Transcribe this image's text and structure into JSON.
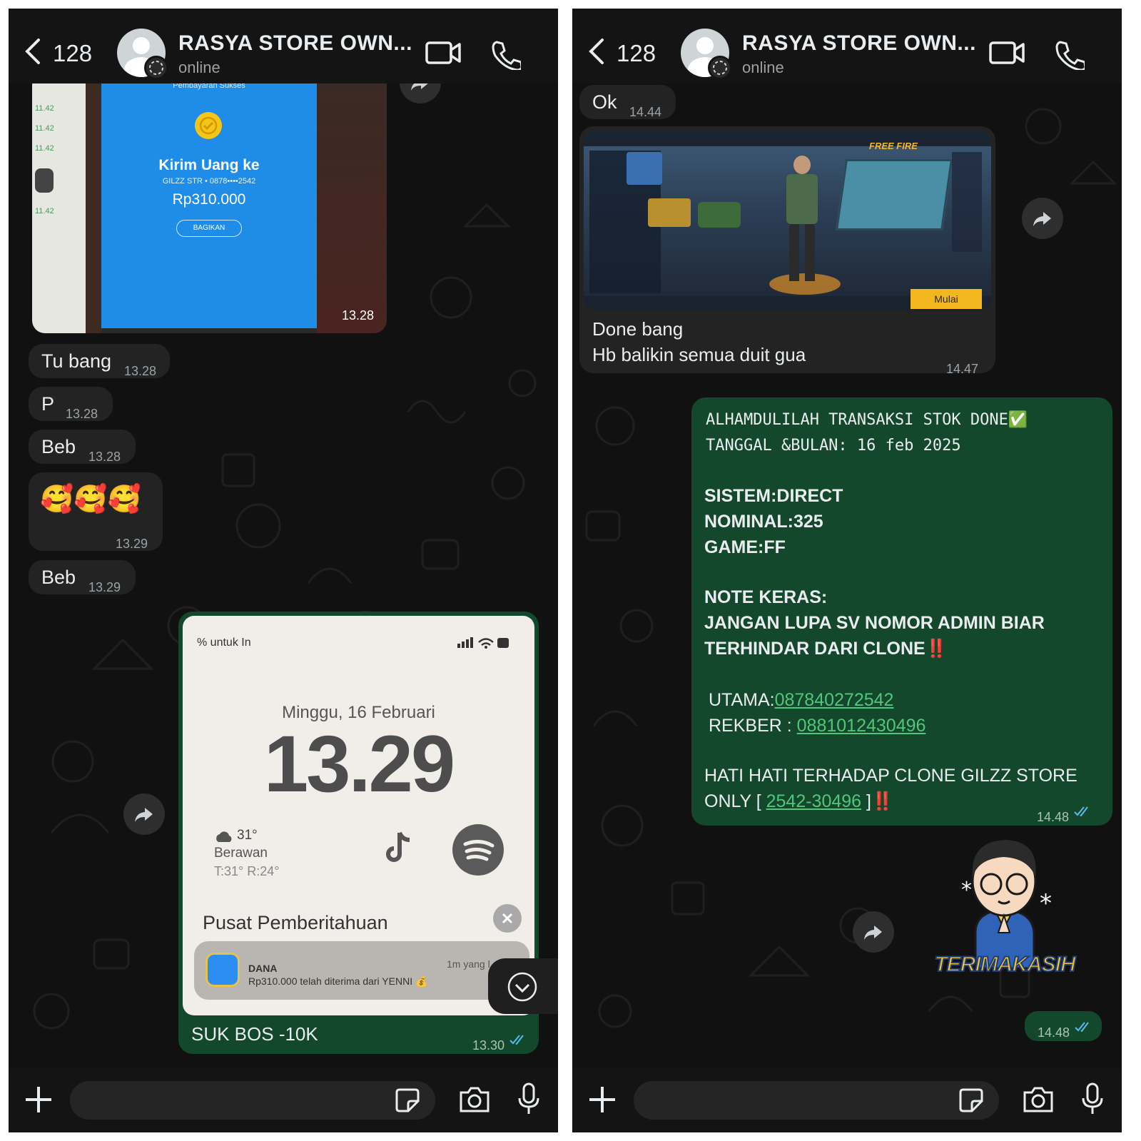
{
  "left": {
    "header": {
      "back_count": "128",
      "contact_name": "RASYA STORE OWN...",
      "status": "online"
    },
    "messages": {
      "image1": {
        "time": "13.28",
        "receipt_header": "Pembayaran Sukses",
        "receipt_title": "Kirim Uang ke",
        "receipt_sub": "GILZZ STR • 0878••••2542",
        "receipt_amount": "Rp310.000",
        "receipt_share": "BAGIKAN",
        "side_times": [
          "11.42",
          "11.42",
          "11.42",
          "11.42"
        ]
      },
      "m1": {
        "text": "Tu bang",
        "time": "13.28"
      },
      "m2": {
        "text": "P",
        "time": "13.28"
      },
      "m3": {
        "text": "Beb",
        "time": "13.28"
      },
      "m4": {
        "emoji": "🥰🥰🥰",
        "time": "13.29"
      },
      "m5": {
        "text": "Beb",
        "time": "13.29"
      },
      "image2": {
        "status_text": "% untuk In",
        "date": "Minggu, 16 Februari",
        "clock": "13.29",
        "weather_temp": "31°",
        "weather_desc": "Berawan",
        "weather_range": "T:31° R:24°",
        "notif_center": "Pusat Pemberitahuan",
        "notif_app": "DANA",
        "notif_text": "Rp310.000 telah diterima dari YENNI 💰",
        "notif_time": "1m yang l",
        "caption": "SUK BOS -10K",
        "time": "13.30"
      }
    }
  },
  "right": {
    "header": {
      "back_count": "128",
      "contact_name": "RASYA STORE OWN...",
      "status": "online"
    },
    "messages": {
      "m1": {
        "text": "Ok",
        "time": "14.44"
      },
      "image1": {
        "game_logo": "FREE FIRE",
        "start_button": "Mulai",
        "caption_line1": "Done bang",
        "caption_line2": "Hb balikin semua duit gua",
        "time": "14.47"
      },
      "m2": {
        "line1": "ALHAMDULILAH TRANSAKSI STOK DONE✅",
        "line2": "TANGGAL &BULAN: 16 feb 2025",
        "sistem": "SISTEM:DIRECT",
        "nominal": "NOMINAL:325",
        "game": "GAME:FF",
        "note_title": "NOTE KERAS:",
        "note_line1": "JANGAN LUPA SV NOMOR ADMIN BIAR",
        "note_line2": "TERHINDAR DARI CLONE‼️",
        "utama_label": "UTAMA:",
        "utama_number": "087840272542",
        "rekber_label": "REKBER : ",
        "rekber_number": "0881012430496",
        "warn_line1": "HATI HATI TERHADAP CLONE GILZZ STORE",
        "warn_prefix": "ONLY [ ",
        "warn_link": "2542-30496",
        "warn_suffix": " ]‼️",
        "time": "14.48"
      },
      "sticker": {
        "text": "TERIMAKASIH",
        "time": "14.48"
      }
    }
  },
  "colors": {
    "outgoing": "#14482c",
    "incoming": "#232323",
    "link": "#53c57a",
    "tick": "#53bdeb"
  }
}
